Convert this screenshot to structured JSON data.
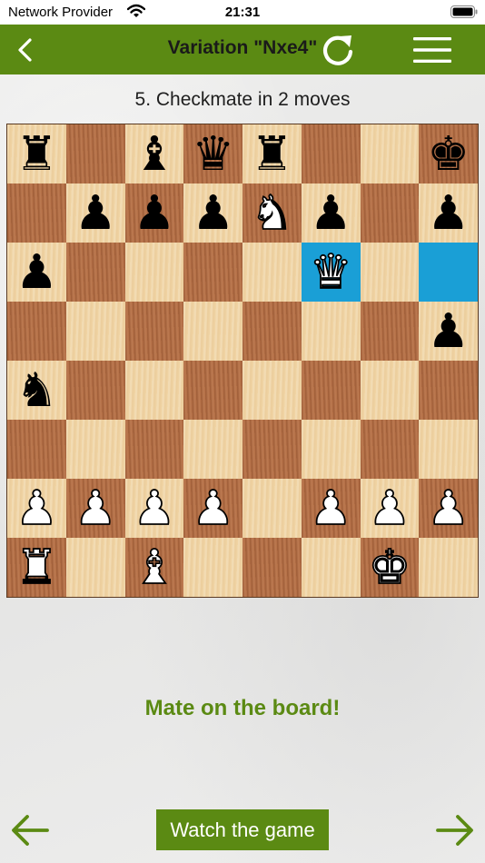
{
  "status_bar": {
    "carrier": "Network Provider",
    "time": "21:31"
  },
  "nav": {
    "title": "Variation \"Nxe4\""
  },
  "puzzle": {
    "title": "5. Checkmate in 2 moves"
  },
  "colors": {
    "accent": "#5b8a13",
    "highlight": "#1a9fd6",
    "light_square": "#f0d4a4",
    "dark_square": "#b36e45"
  },
  "board": {
    "highlighted": [
      "f6",
      "h6"
    ],
    "squares": [
      [
        {
          "n": "a8",
          "p": "rook",
          "c": "black"
        },
        {
          "n": "b8"
        },
        {
          "n": "c8",
          "p": "bishop",
          "c": "black"
        },
        {
          "n": "d8",
          "p": "queen",
          "c": "black"
        },
        {
          "n": "e8",
          "p": "rook",
          "c": "black"
        },
        {
          "n": "f8"
        },
        {
          "n": "g8"
        },
        {
          "n": "h8",
          "p": "king",
          "c": "black"
        }
      ],
      [
        {
          "n": "a7"
        },
        {
          "n": "b7",
          "p": "pawn",
          "c": "black"
        },
        {
          "n": "c7",
          "p": "pawn",
          "c": "black"
        },
        {
          "n": "d7",
          "p": "pawn",
          "c": "black"
        },
        {
          "n": "e7",
          "p": "knight",
          "c": "white"
        },
        {
          "n": "f7",
          "p": "pawn",
          "c": "black"
        },
        {
          "n": "g7"
        },
        {
          "n": "h7",
          "p": "pawn",
          "c": "black"
        }
      ],
      [
        {
          "n": "a6",
          "p": "pawn",
          "c": "black"
        },
        {
          "n": "b6"
        },
        {
          "n": "c6"
        },
        {
          "n": "d6"
        },
        {
          "n": "e6"
        },
        {
          "n": "f6",
          "p": "queen",
          "c": "white"
        },
        {
          "n": "g6"
        },
        {
          "n": "h6"
        }
      ],
      [
        {
          "n": "a5"
        },
        {
          "n": "b5"
        },
        {
          "n": "c5"
        },
        {
          "n": "d5"
        },
        {
          "n": "e5"
        },
        {
          "n": "f5"
        },
        {
          "n": "g5"
        },
        {
          "n": "h5",
          "p": "pawn",
          "c": "black"
        }
      ],
      [
        {
          "n": "a4",
          "p": "knight",
          "c": "black"
        },
        {
          "n": "b4"
        },
        {
          "n": "c4"
        },
        {
          "n": "d4"
        },
        {
          "n": "e4"
        },
        {
          "n": "f4"
        },
        {
          "n": "g4"
        },
        {
          "n": "h4"
        }
      ],
      [
        {
          "n": "a3"
        },
        {
          "n": "b3"
        },
        {
          "n": "c3"
        },
        {
          "n": "d3"
        },
        {
          "n": "e3"
        },
        {
          "n": "f3"
        },
        {
          "n": "g3"
        },
        {
          "n": "h3"
        }
      ],
      [
        {
          "n": "a2",
          "p": "pawn",
          "c": "white"
        },
        {
          "n": "b2",
          "p": "pawn",
          "c": "white"
        },
        {
          "n": "c2",
          "p": "pawn",
          "c": "white"
        },
        {
          "n": "d2",
          "p": "pawn",
          "c": "white"
        },
        {
          "n": "e2"
        },
        {
          "n": "f2",
          "p": "pawn",
          "c": "white"
        },
        {
          "n": "g2",
          "p": "pawn",
          "c": "white"
        },
        {
          "n": "h2",
          "p": "pawn",
          "c": "white"
        }
      ],
      [
        {
          "n": "a1",
          "p": "rook",
          "c": "white"
        },
        {
          "n": "b1"
        },
        {
          "n": "c1",
          "p": "bishop",
          "c": "white"
        },
        {
          "n": "d1"
        },
        {
          "n": "e1"
        },
        {
          "n": "f1"
        },
        {
          "n": "g1",
          "p": "king",
          "c": "white"
        },
        {
          "n": "h1"
        }
      ]
    ]
  },
  "message": "Mate on the board!",
  "buttons": {
    "watch_game": "Watch the game"
  },
  "icons": {
    "back": "chevron-left-icon",
    "refresh": "refresh-icon",
    "menu": "hamburger-menu-icon",
    "prev": "arrow-left-icon",
    "next": "arrow-right-icon"
  }
}
